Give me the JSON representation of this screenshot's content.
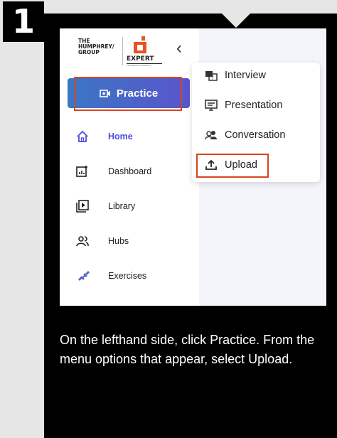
{
  "step": {
    "number": "1"
  },
  "logo": {
    "company": "THE\nHUMPHREY/\nGROUP",
    "product": "EXPERT",
    "tagline": "LEADERSHIP INSIGHTS"
  },
  "sidebar": {
    "practice_label": "Practice",
    "items": [
      {
        "label": "Home",
        "icon": "home-icon",
        "active": true
      },
      {
        "label": "Dashboard",
        "icon": "dashboard-icon",
        "active": false
      },
      {
        "label": "Library",
        "icon": "library-icon",
        "active": false
      },
      {
        "label": "Hubs",
        "icon": "hubs-icon",
        "active": false
      },
      {
        "label": "Exercises",
        "icon": "exercises-icon",
        "active": false
      }
    ]
  },
  "menu": {
    "items": [
      {
        "label": "Interview",
        "icon": "interview-icon"
      },
      {
        "label": "Presentation",
        "icon": "presentation-icon"
      },
      {
        "label": "Conversation",
        "icon": "conversation-icon"
      },
      {
        "label": "Upload",
        "icon": "upload-icon"
      }
    ]
  },
  "instructions": "On the lefthand side, click Practice. From the menu options that appear, select Upload.",
  "colors": {
    "highlight": "#d9451e",
    "accent": "#4a4de0",
    "logo": "#e8531f"
  }
}
